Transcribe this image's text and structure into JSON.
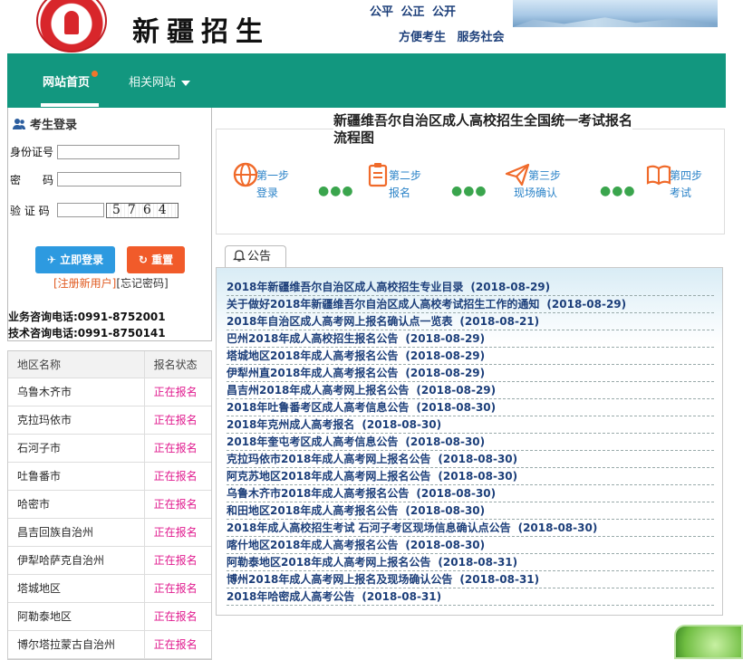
{
  "header": {
    "brand": "新疆招生",
    "slogan_line1": "公平 公正 公开",
    "slogan_line2": "方便考生  服务社会"
  },
  "nav": {
    "home": "网站首页",
    "related": "相关网站"
  },
  "login": {
    "title": "考生登录",
    "id_label": "身份证号",
    "password_label": "密　　码",
    "captcha_label": "验 证 码",
    "captcha_text": "5764",
    "login_button": "立即登录",
    "reset_button": "重置",
    "register_link": "[注册新用户]",
    "forgot_link": "[忘记密码]",
    "phone_business": "业务咨询电话:0991-8752001",
    "phone_tech": "技术咨询电话:0991-8750141"
  },
  "regions": {
    "headers": [
      "地区名称",
      "报名状态"
    ],
    "rows": [
      {
        "name": "乌鲁木齐市",
        "status": "正在报名"
      },
      {
        "name": "克拉玛依市",
        "status": "正在报名"
      },
      {
        "name": "石河子市",
        "status": "正在报名"
      },
      {
        "name": "吐鲁番市",
        "status": "正在报名"
      },
      {
        "name": "哈密市",
        "status": "正在报名"
      },
      {
        "name": "昌吉回族自治州",
        "status": "正在报名"
      },
      {
        "name": "伊犁哈萨克自治州",
        "status": "正在报名"
      },
      {
        "name": "塔城地区",
        "status": "正在报名"
      },
      {
        "name": "阿勒泰地区",
        "status": "正在报名"
      },
      {
        "name": "博尔塔拉蒙古自治州",
        "status": "正在报名"
      }
    ]
  },
  "flow": {
    "title": "新疆维吾尔自治区成人高校招生全国统一考试报名流程图",
    "steps": [
      {
        "num": "第一步",
        "name": "登录"
      },
      {
        "num": "第二步",
        "name": "报名"
      },
      {
        "num": "第三步",
        "name": "现场确认"
      },
      {
        "num": "第四步",
        "name": "考试"
      }
    ]
  },
  "notices": {
    "tab": "公告",
    "items": [
      {
        "title": "2018年新疆维吾尔自治区成人高校招生专业目录",
        "date": "(2018-08-29)"
      },
      {
        "title": "关于做好2018年新疆维吾尔自治区成人高校考试招生工作的通知",
        "date": "(2018-08-29)"
      },
      {
        "title": "2018年自治区成人高考网上报名确认点一览表",
        "date": "(2018-08-21)"
      },
      {
        "title": "巴州2018年成人高校招生报名公告",
        "date": "(2018-08-29)"
      },
      {
        "title": "塔城地区2018年成人高考报名公告",
        "date": "(2018-08-29)"
      },
      {
        "title": "伊犁州直2018年成人高考报名公告",
        "date": "(2018-08-29)"
      },
      {
        "title": "昌吉州2018年成人高考网上报名公告",
        "date": "(2018-08-29)"
      },
      {
        "title": "2018年吐鲁番考区成人高考信息公告",
        "date": "(2018-08-30)"
      },
      {
        "title": "2018年克州成人高考报名",
        "date": "(2018-08-30)"
      },
      {
        "title": "2018年奎屯考区成人高考信息公告",
        "date": "(2018-08-30)"
      },
      {
        "title": "克拉玛依市2018年成人高考网上报名公告",
        "date": "(2018-08-30)"
      },
      {
        "title": "阿克苏地区2018年成人高考网上报名公告",
        "date": "(2018-08-30)"
      },
      {
        "title": "乌鲁木齐市2018年成人高考报名公告",
        "date": "(2018-08-30)"
      },
      {
        "title": "和田地区2018年成人高考报名公告",
        "date": "(2018-08-30)"
      },
      {
        "title": "2018年成人高校招生考试 石河子考区现场信息确认点公告",
        "date": "(2018-08-30)"
      },
      {
        "title": "喀什地区2018年成人高考报名公告",
        "date": "(2018-08-30)"
      },
      {
        "title": "阿勒泰地区2018年成人高考网上报名公告",
        "date": "(2018-08-31)"
      },
      {
        "title": "博州2018年成人高考网上报名及现场确认公告",
        "date": "(2018-08-31)"
      },
      {
        "title": "2018年哈密成人高考公告",
        "date": "(2018-08-31)"
      }
    ]
  }
}
